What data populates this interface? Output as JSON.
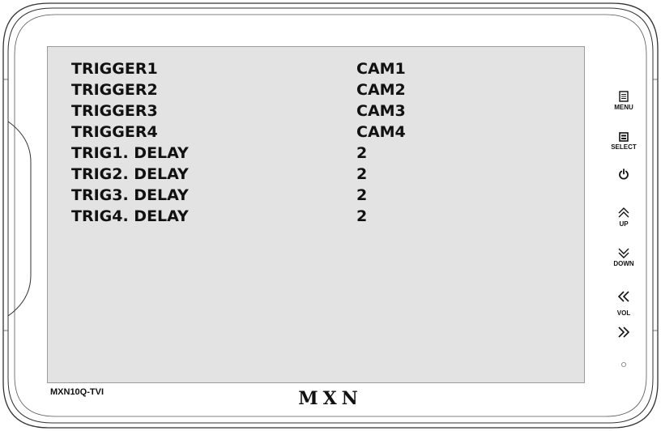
{
  "menu": {
    "rows": [
      {
        "label": "TRIGGER1",
        "value": "CAM1"
      },
      {
        "label": "TRIGGER2",
        "value": "CAM2"
      },
      {
        "label": "TRIGGER3",
        "value": "CAM3"
      },
      {
        "label": "TRIGGER4",
        "value": "CAM4"
      },
      {
        "label": "TRIG1. DELAY",
        "value": "2"
      },
      {
        "label": "TRIG2. DELAY",
        "value": "2"
      },
      {
        "label": "TRIG3. DELAY",
        "value": "2"
      },
      {
        "label": "TRIG4. DELAY",
        "value": "2"
      }
    ]
  },
  "device": {
    "model": "MXN10Q-TVI",
    "brand": "MXN"
  },
  "buttons": {
    "menu": "MENU",
    "select": "SELECT",
    "up": "UP",
    "down": "DOWN",
    "vol": "VOL"
  },
  "icons": {
    "menu": "menu-icon",
    "select": "select-icon",
    "power": "power-icon",
    "up": "chevron-up-icon",
    "down": "chevron-down-icon",
    "vol_down": "double-chevron-left-icon",
    "vol_up": "double-chevron-right-icon",
    "indicator": "status-led-icon"
  },
  "colors": {
    "screen_background": "#e3e3e3",
    "text": "#111111",
    "bezel": "#ffffff",
    "outline": "#333333"
  }
}
